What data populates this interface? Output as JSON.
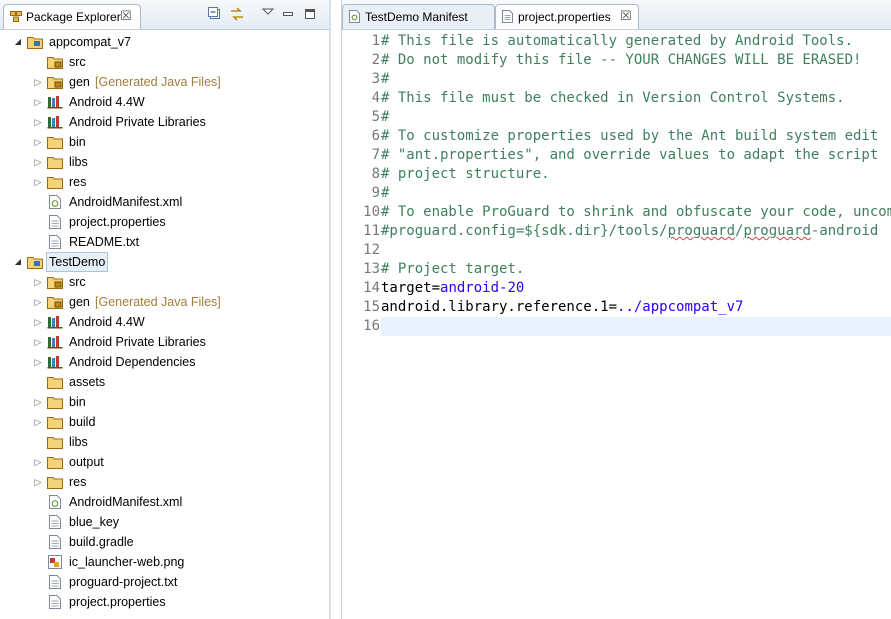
{
  "explorer": {
    "title": "Package Explorer",
    "close_glyph": "☒",
    "toolbar_icons": [
      "collapse-all-icon",
      "link-with-editor-icon",
      "view-menu-icon",
      "minimize-icon",
      "maximize-icon"
    ],
    "tree": [
      {
        "label": "appcompat_v7",
        "depth": 0,
        "expand": "open",
        "icon": "project-folder-icon"
      },
      {
        "label": "src",
        "depth": 1,
        "expand": "none",
        "icon": "package-folder-icon"
      },
      {
        "label": "gen",
        "suffix": "[Generated Java Files]",
        "depth": 1,
        "expand": "closed",
        "icon": "package-folder-icon"
      },
      {
        "label": "Android 4.4W",
        "depth": 1,
        "expand": "closed",
        "icon": "library-icon"
      },
      {
        "label": "Android Private Libraries",
        "depth": 1,
        "expand": "closed",
        "icon": "library-icon"
      },
      {
        "label": "bin",
        "depth": 1,
        "expand": "closed",
        "icon": "folder-icon"
      },
      {
        "label": "libs",
        "depth": 1,
        "expand": "closed",
        "icon": "folder-icon"
      },
      {
        "label": "res",
        "depth": 1,
        "expand": "closed",
        "icon": "folder-icon"
      },
      {
        "label": "AndroidManifest.xml",
        "depth": 1,
        "expand": "none",
        "icon": "android-manifest-icon"
      },
      {
        "label": "project.properties",
        "depth": 1,
        "expand": "none",
        "icon": "file-icon"
      },
      {
        "label": "README.txt",
        "depth": 1,
        "expand": "none",
        "icon": "file-icon"
      },
      {
        "label": "TestDemo",
        "depth": 0,
        "expand": "open",
        "icon": "project-folder-icon",
        "selected": true
      },
      {
        "label": "src",
        "depth": 1,
        "expand": "closed",
        "icon": "package-folder-icon"
      },
      {
        "label": "gen",
        "suffix": "[Generated Java Files]",
        "depth": 1,
        "expand": "closed",
        "icon": "package-folder-icon"
      },
      {
        "label": "Android 4.4W",
        "depth": 1,
        "expand": "closed",
        "icon": "library-icon"
      },
      {
        "label": "Android Private Libraries",
        "depth": 1,
        "expand": "closed",
        "icon": "library-icon"
      },
      {
        "label": "Android Dependencies",
        "depth": 1,
        "expand": "closed",
        "icon": "library-icon"
      },
      {
        "label": "assets",
        "depth": 1,
        "expand": "none",
        "icon": "folder-icon"
      },
      {
        "label": "bin",
        "depth": 1,
        "expand": "closed",
        "icon": "folder-icon"
      },
      {
        "label": "build",
        "depth": 1,
        "expand": "closed",
        "icon": "folder-icon"
      },
      {
        "label": "libs",
        "depth": 1,
        "expand": "none",
        "icon": "folder-icon"
      },
      {
        "label": "output",
        "depth": 1,
        "expand": "closed",
        "icon": "folder-icon"
      },
      {
        "label": "res",
        "depth": 1,
        "expand": "closed",
        "icon": "folder-icon"
      },
      {
        "label": "AndroidManifest.xml",
        "depth": 1,
        "expand": "none",
        "icon": "android-manifest-icon"
      },
      {
        "label": "blue_key",
        "depth": 1,
        "expand": "none",
        "icon": "file-icon"
      },
      {
        "label": "build.gradle",
        "depth": 1,
        "expand": "none",
        "icon": "file-icon"
      },
      {
        "label": "ic_launcher-web.png",
        "depth": 1,
        "expand": "none",
        "icon": "image-file-icon"
      },
      {
        "label": "proguard-project.txt",
        "depth": 1,
        "expand": "none",
        "icon": "file-icon"
      },
      {
        "label": "project.properties",
        "depth": 1,
        "expand": "none",
        "icon": "file-icon"
      }
    ]
  },
  "editor": {
    "tabs": [
      {
        "label": "TestDemo Manifest",
        "active": false,
        "icon": "android-manifest-icon"
      },
      {
        "label": "project.properties",
        "active": true,
        "icon": "file-icon",
        "close_glyph": "☒"
      }
    ],
    "current_line": 16,
    "lines": [
      {
        "n": "1",
        "parts": [
          {
            "t": "# This file is automatically generated by Android Tools.",
            "s": "cmt"
          }
        ]
      },
      {
        "n": "2",
        "parts": [
          {
            "t": "# Do not modify this file -- YOUR CHANGES WILL BE ERASED!",
            "s": "cmt"
          }
        ]
      },
      {
        "n": "3",
        "parts": [
          {
            "t": "#",
            "s": "cmt"
          }
        ]
      },
      {
        "n": "4",
        "parts": [
          {
            "t": "# This file must be checked in Version Control Systems.",
            "s": "cmt"
          }
        ]
      },
      {
        "n": "5",
        "parts": [
          {
            "t": "#",
            "s": "cmt"
          }
        ]
      },
      {
        "n": "6",
        "parts": [
          {
            "t": "# To customize properties used by the Ant build system edit",
            "s": "cmt"
          }
        ]
      },
      {
        "n": "7",
        "parts": [
          {
            "t": "# \"ant.properties\", and override values to adapt the script",
            "s": "cmt"
          }
        ]
      },
      {
        "n": "8",
        "parts": [
          {
            "t": "# project structure.",
            "s": "cmt"
          }
        ]
      },
      {
        "n": "9",
        "parts": [
          {
            "t": "#",
            "s": "cmt"
          }
        ]
      },
      {
        "n": "10",
        "parts": [
          {
            "t": "# To enable ProGuard to shrink and obfuscate your code, uncomment",
            "s": "cmt"
          }
        ]
      },
      {
        "n": "11",
        "parts": [
          {
            "t": "#proguard.config=${sdk.dir}/tools/",
            "s": "cmt"
          },
          {
            "t": "proguard",
            "s": "cmt sq"
          },
          {
            "t": "/",
            "s": "cmt"
          },
          {
            "t": "proguard",
            "s": "cmt sq"
          },
          {
            "t": "-android",
            "s": "cmt"
          }
        ]
      },
      {
        "n": "12",
        "parts": [
          {
            "t": "",
            "s": ""
          }
        ]
      },
      {
        "n": "13",
        "parts": [
          {
            "t": "# Project target.",
            "s": "cmt"
          }
        ]
      },
      {
        "n": "14",
        "parts": [
          {
            "t": "target=",
            "s": ""
          },
          {
            "t": "android-20",
            "s": "val"
          }
        ]
      },
      {
        "n": "15",
        "parts": [
          {
            "t": "android.library.reference.1=",
            "s": ""
          },
          {
            "t": "../appcompat_v7",
            "s": "val"
          }
        ]
      },
      {
        "n": "16",
        "parts": [
          {
            "t": "",
            "s": ""
          }
        ]
      }
    ]
  }
}
